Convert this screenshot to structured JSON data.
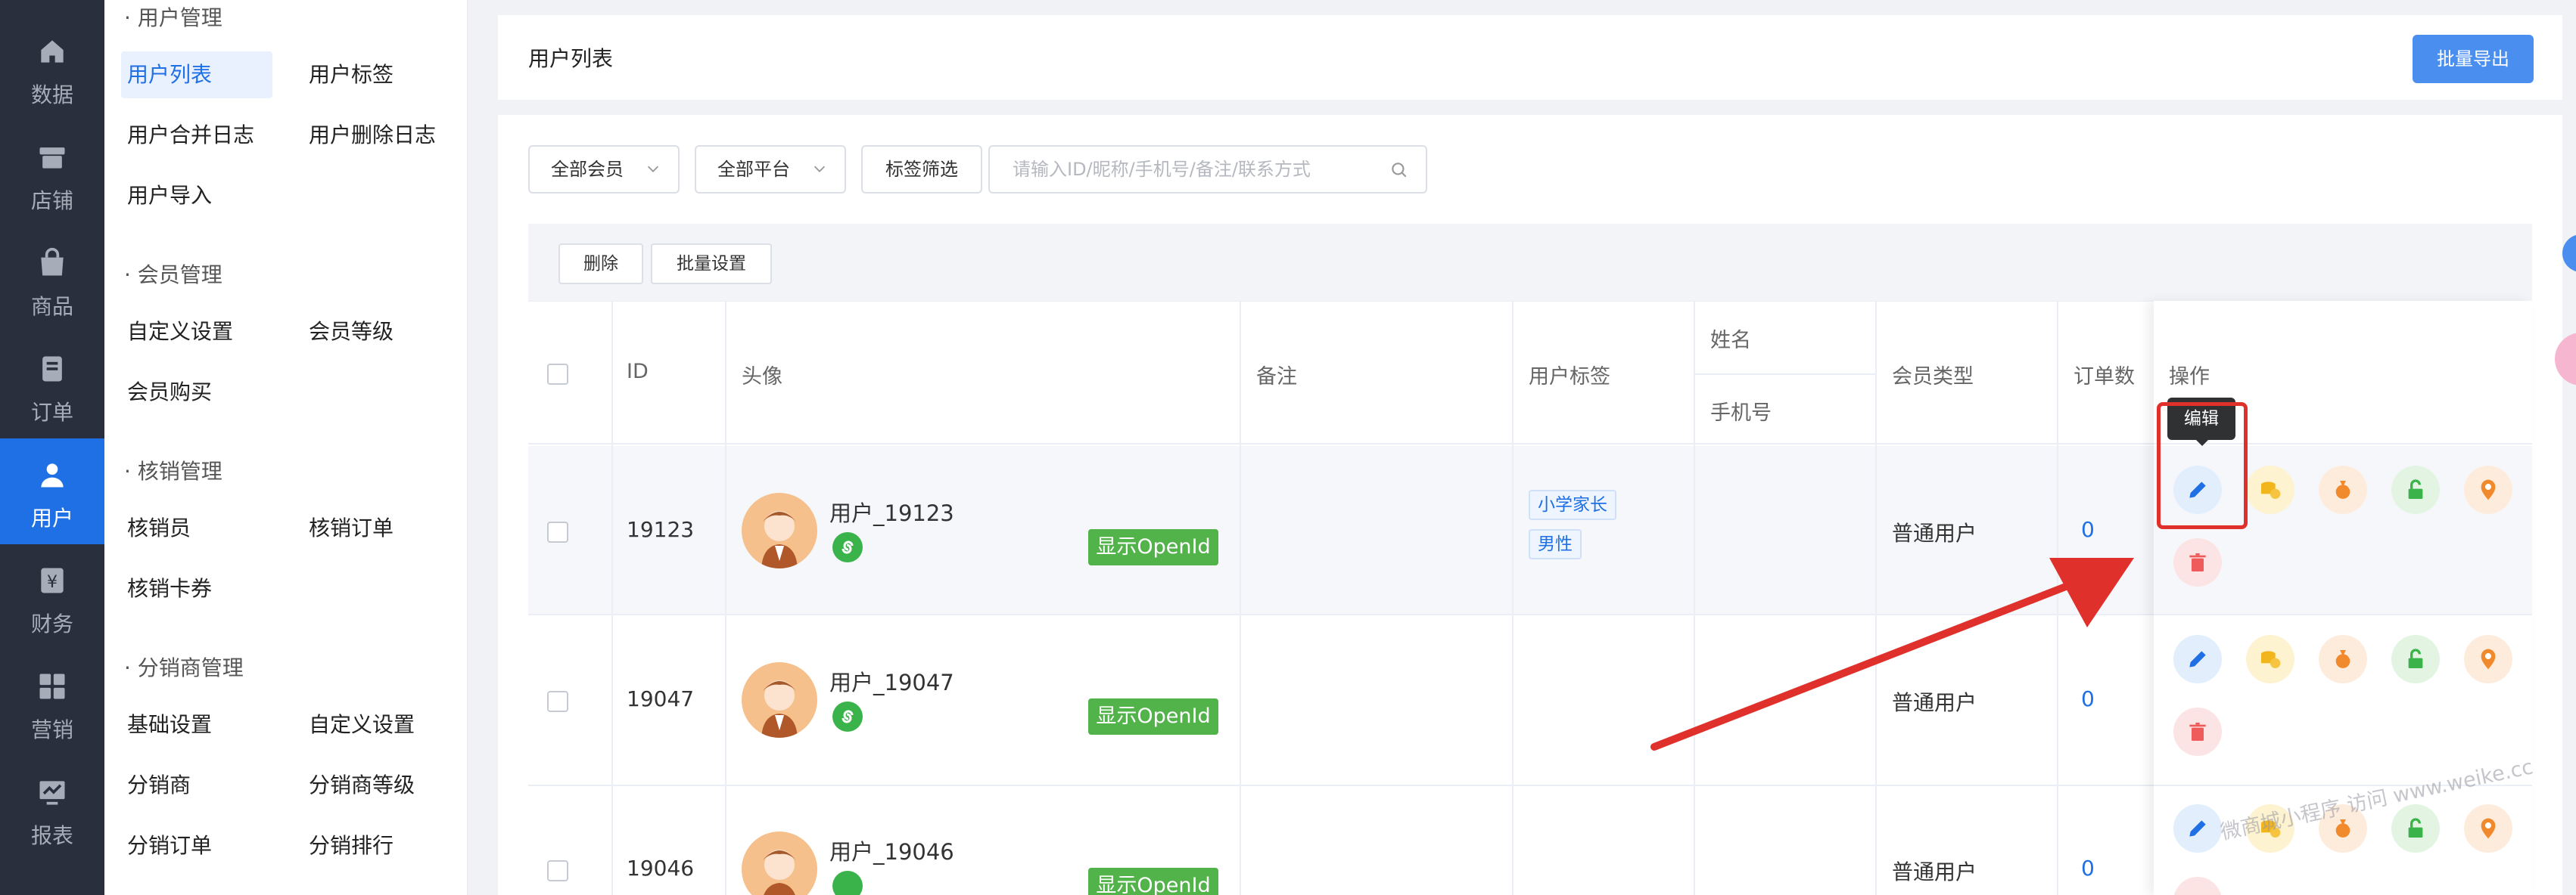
{
  "rail": {
    "items": [
      {
        "label": "数据",
        "icon": "home-icon"
      },
      {
        "label": "店铺",
        "icon": "shop-icon"
      },
      {
        "label": "商品",
        "icon": "bag-icon"
      },
      {
        "label": "订单",
        "icon": "order-icon"
      },
      {
        "label": "用户",
        "icon": "user-icon",
        "active": true
      },
      {
        "label": "财务",
        "icon": "finance-icon"
      },
      {
        "label": "营销",
        "icon": "marketing-icon"
      },
      {
        "label": "报表",
        "icon": "report-icon"
      }
    ]
  },
  "submenu": {
    "user_group": "· 用户管理",
    "user_list": "用户列表",
    "user_tags": "用户标签",
    "merge_log": "用户合并日志",
    "delete_log": "用户删除日志",
    "user_import": "用户导入",
    "member_group": "· 会员管理",
    "custom_settings": "自定义设置",
    "member_level": "会员等级",
    "member_purchase": "会员购买",
    "verify_group": "· 核销管理",
    "verifier": "核销员",
    "verify_orders": "核销订单",
    "verify_cards": "核销卡券",
    "distrib_group": "· 分销商管理",
    "basic_settings": "基础设置",
    "distrib_custom": "自定义设置",
    "distributor": "分销商",
    "distrib_level": "分销商等级",
    "distrib_orders": "分销订单",
    "distrib_rank": "分销排行"
  },
  "header": {
    "title": "用户列表",
    "export_label": "批量导出"
  },
  "filters": {
    "member": "全部会员",
    "platform": "全部平台",
    "tag_filter": "标签筛选",
    "search_placeholder": "请输入ID/昵称/手机号/备注/联系方式"
  },
  "actions": {
    "delete": "删除",
    "batch_settings": "批量设置"
  },
  "table": {
    "columns": {
      "id": "ID",
      "avatar": "头像",
      "remark": "备注",
      "tags": "用户标签",
      "name": "姓名",
      "phone": "手机号",
      "member_type": "会员类型",
      "orders": "订单数",
      "ops": "操作"
    },
    "rows": [
      {
        "id": "19123",
        "nickname": "用户_19123",
        "openid_label": "显示OpenId",
        "tags": [
          "小学家长",
          "男性"
        ],
        "member_type": "普通用户",
        "orders": "0"
      },
      {
        "id": "19047",
        "nickname": "用户_19047",
        "openid_label": "显示OpenId",
        "tags": [],
        "member_type": "普通用户",
        "orders": "0"
      },
      {
        "id": "19046",
        "nickname": "用户_19046",
        "openid_label": "显示OpenId",
        "tags": [],
        "member_type": "普通用户",
        "orders": "0"
      }
    ]
  },
  "tooltip": "编辑",
  "watermark": "微商城小程序 访问 www.weike.cc",
  "colors": {
    "brand": "#1f6fe5",
    "rail_bg": "#292f3d",
    "openid_green": "#52b34a",
    "annotation_red": "#e0302b"
  }
}
